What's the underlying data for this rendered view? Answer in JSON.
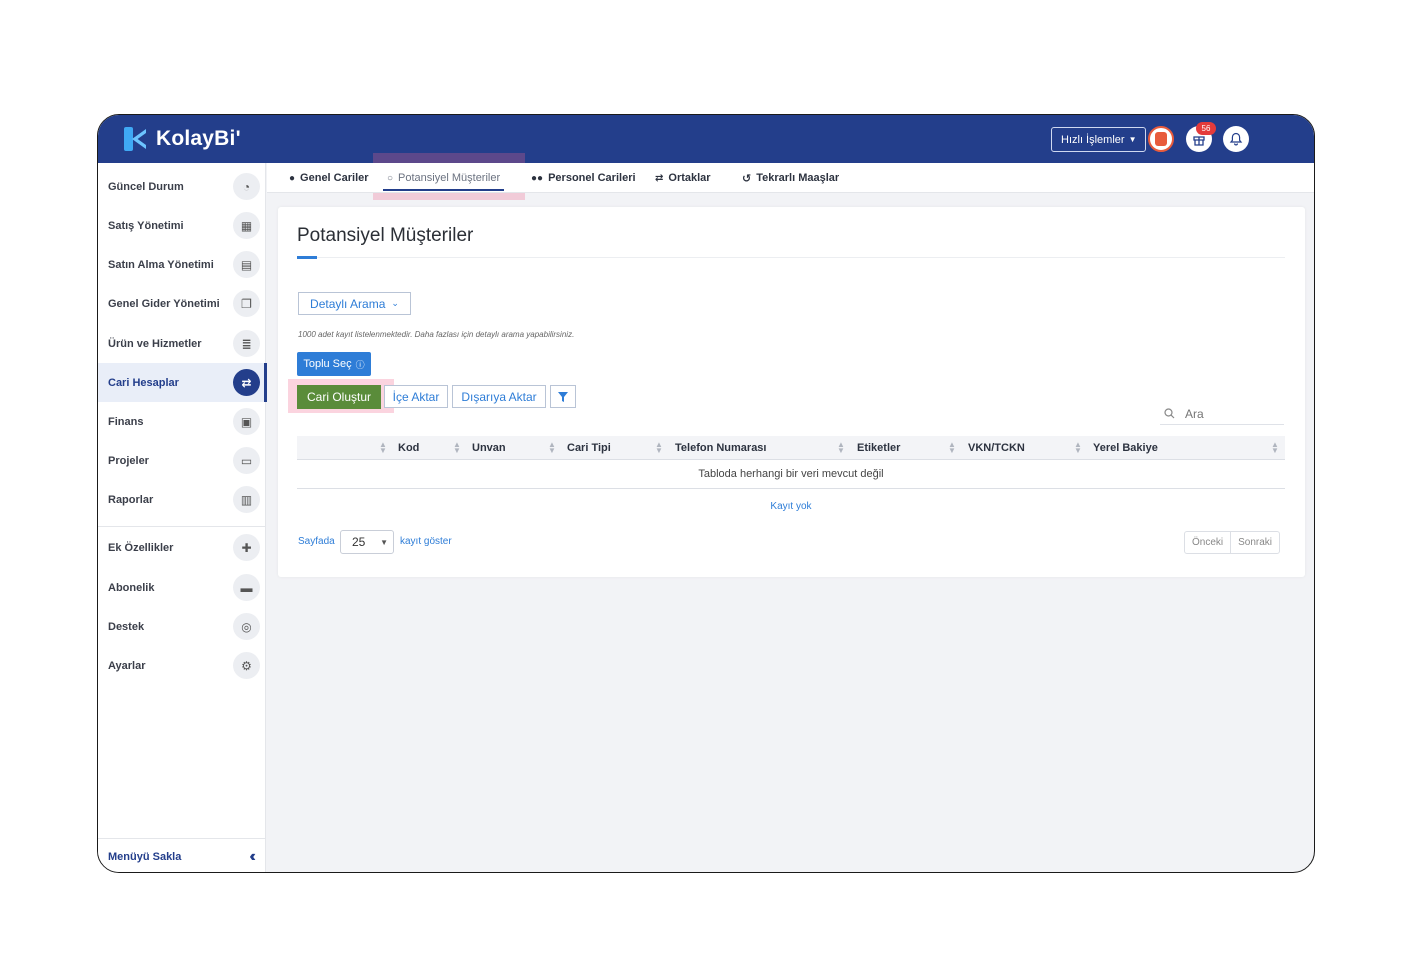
{
  "header": {
    "logo_text": "KolayBi'",
    "quick_actions_label": "Hızlı İşlemler",
    "notification_count": "56"
  },
  "sidebar": {
    "items": [
      {
        "label": "Güncel Durum",
        "icon": "gauge-icon"
      },
      {
        "label": "Satış Yönetimi",
        "icon": "calculator-icon"
      },
      {
        "label": "Satın Alma Yönetimi",
        "icon": "document-icon"
      },
      {
        "label": "Genel Gider Yönetimi",
        "icon": "copy-icon"
      },
      {
        "label": "Ürün ve Hizmetler",
        "icon": "database-icon"
      },
      {
        "label": "Cari Hesaplar",
        "icon": "handshake-icon",
        "active": true
      },
      {
        "label": "Finans",
        "icon": "money-icon"
      },
      {
        "label": "Projeler",
        "icon": "folder-icon"
      },
      {
        "label": "Raporlar",
        "icon": "chart-icon"
      },
      {
        "label": "Ek Özellikler",
        "icon": "puzzle-icon"
      },
      {
        "label": "Abonelik",
        "icon": "credit-card-icon"
      },
      {
        "label": "Destek",
        "icon": "lifebuoy-icon"
      },
      {
        "label": "Ayarlar",
        "icon": "gears-icon"
      }
    ],
    "hide_menu_label": "Menüyü Sakla"
  },
  "tabs": [
    {
      "label": "Genel Cariler",
      "icon": "user-icon"
    },
    {
      "label": "Potansiyel Müşteriler",
      "icon": "user-outline-icon",
      "active": true
    },
    {
      "label": "Personel Carileri",
      "icon": "users-icon"
    },
    {
      "label": "Ortaklar",
      "icon": "handshake-icon"
    },
    {
      "label": "Tekrarlı Maaşlar",
      "icon": "undo-icon"
    }
  ],
  "main": {
    "title": "Potansiyel Müşteriler",
    "detailed_search_label": "Detaylı Arama",
    "limit_note": "1000 adet kayıt listelenmektedir. Daha fazlası için detaylı arama yapabilirsiniz.",
    "bulk_select_label": "Toplu Seç",
    "create_label": "Cari Oluştur",
    "import_label": "İçe Aktar",
    "export_label": "Dışarıya Aktar",
    "search_placeholder": "Ara"
  },
  "table": {
    "columns": [
      "Kod",
      "Unvan",
      "Cari Tipi",
      "Telefon Numarası",
      "Etiketler",
      "VKN/TCKN",
      "Yerel Bakiye"
    ],
    "empty_message": "Tabloda herhangi bir veri mevcut değil",
    "no_records": "Kayıt yok"
  },
  "pagination": {
    "per_page_prefix": "Sayfada",
    "per_page_value": "25",
    "per_page_suffix": "kayıt göster",
    "prev_label": "Önceki",
    "next_label": "Sonraki"
  },
  "colors": {
    "brand_blue": "#233e8b",
    "accent_blue": "#2e7dd7",
    "create_green": "#5a8c3a",
    "highlight_pink": "#f0648c"
  }
}
